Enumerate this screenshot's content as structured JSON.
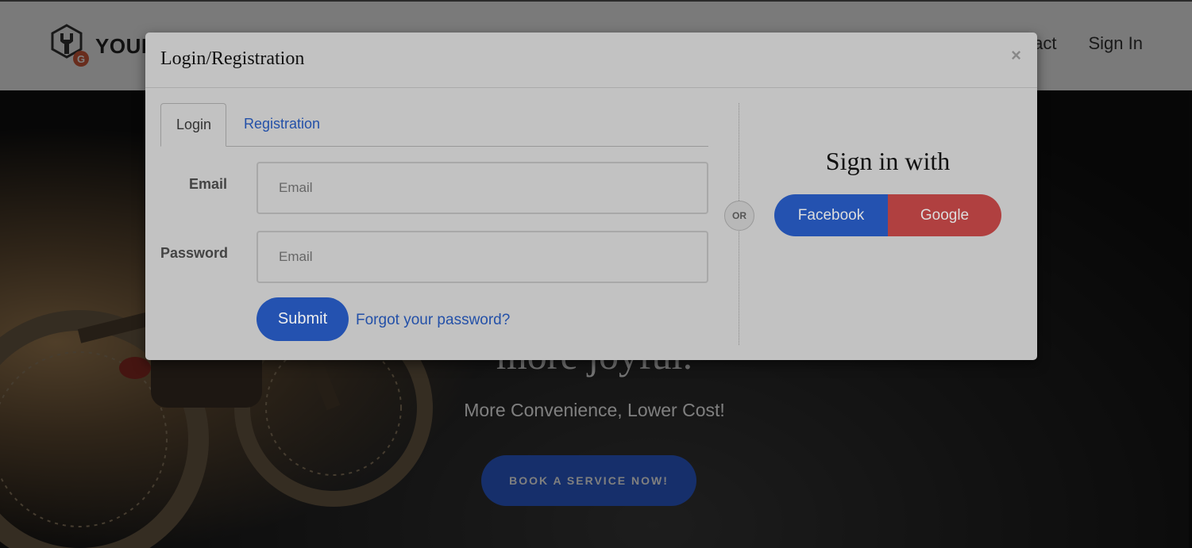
{
  "page": {
    "brand_text": "YOUR",
    "nav": [
      "Contact",
      "Sign In"
    ],
    "hero": {
      "heading": "more joyful.",
      "subheading": "More Convenience, Lower Cost!",
      "cta_label": "BOOK A SERVICE NOW!"
    }
  },
  "modal": {
    "title": "Login/Registration",
    "close_label": "×",
    "tabs": [
      {
        "label": "Login",
        "active": true
      },
      {
        "label": "Registration",
        "active": false
      }
    ],
    "email": {
      "label": "Email",
      "placeholder": "Email",
      "value": ""
    },
    "password": {
      "label": "Password",
      "placeholder": "Email",
      "value": ""
    },
    "submit_label": "Submit",
    "forgot_label": "Forgot your password?",
    "or_label": "OR",
    "signin_title": "Sign in with",
    "social": {
      "facebook": "Facebook",
      "google": "Google"
    }
  },
  "colors": {
    "primary": "#2452b0",
    "google": "#b04040",
    "link": "#2350a8"
  }
}
